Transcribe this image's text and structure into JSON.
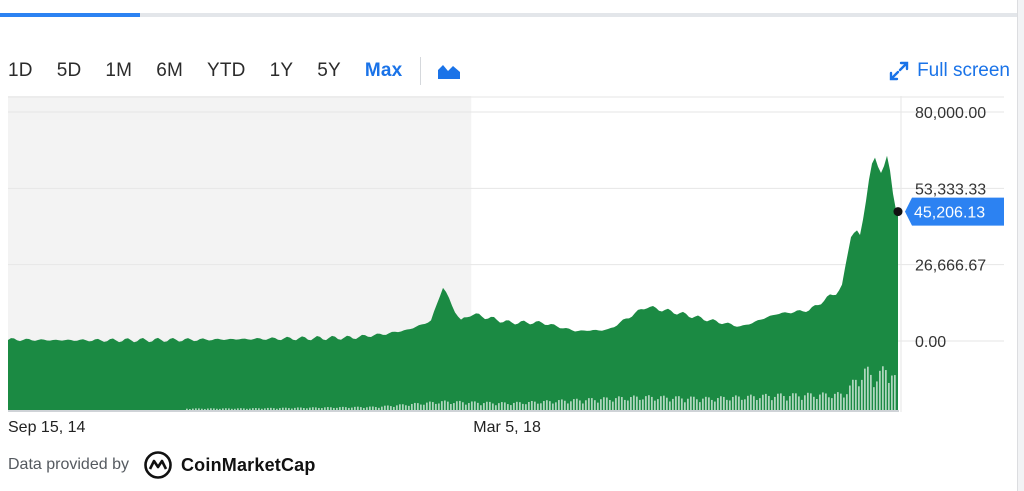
{
  "toolbar": {
    "ranges": [
      "1D",
      "5D",
      "1M",
      "6M",
      "YTD",
      "1Y",
      "5Y",
      "Max"
    ],
    "active_range": "Max",
    "chart_type_icon": "mountain-chart-icon",
    "fullscreen_label": "Full screen"
  },
  "loading_progress": 0.137,
  "footer": {
    "provided_by": "Data provided by",
    "brand": "CoinMarketCap",
    "brand_icon": "coinmarketcap-logo-icon"
  },
  "colors": {
    "area_fill": "#1b8a43",
    "accent": "#1a73e8",
    "last_price_badge": "#2c82f2",
    "shaded_region": "#f3f3f3",
    "grid": "#e6e6e6",
    "volume": "#1b8a43"
  },
  "chart_data": {
    "type": "area",
    "title": "",
    "xlabel": "",
    "ylabel": "",
    "x_ticks": [
      "Sep 15, 14",
      "Mar 5, 18"
    ],
    "y_ticks": [
      0,
      26666.67,
      53333.33,
      80000
    ],
    "y_tick_labels": [
      "0.00",
      "26,666.67",
      "53,333.33",
      "80,000.00"
    ],
    "ylim": [
      0,
      80000
    ],
    "x_range": [
      "2014-09-15",
      "2021-05-15"
    ],
    "grid": true,
    "legend": "none",
    "last_price": 45206.13,
    "last_price_label": "45,206.13",
    "series": [
      {
        "x": [
          "2014-09-15",
          "2015-01-15",
          "2015-06-15",
          "2016-01-15",
          "2016-06-15",
          "2017-01-15",
          "2017-04-15",
          "2017-07-15",
          "2017-09-15",
          "2017-11-15",
          "2017-12-17",
          "2018-01-15",
          "2018-02-05",
          "2018-03-05",
          "2018-06-15",
          "2018-09-15",
          "2018-12-15",
          "2019-03-15",
          "2019-06-26",
          "2019-09-15",
          "2019-12-15",
          "2020-03-13",
          "2020-06-15",
          "2020-09-15",
          "2020-11-15",
          "2020-12-15",
          "2021-01-08",
          "2021-02-01",
          "2021-02-21",
          "2021-03-13",
          "2021-04-14",
          "2021-05-01",
          "2021-05-15"
        ],
        "y": [
          500,
          300,
          250,
          400,
          650,
          1000,
          1200,
          2500,
          4000,
          7000,
          19000,
          11500,
          7000,
          9500,
          6500,
          6400,
          3500,
          3900,
          12000,
          10000,
          7300,
          5000,
          9400,
          10800,
          16000,
          19000,
          40000,
          35000,
          57000,
          61000,
          63000,
          52000,
          45206
        ]
      }
    ],
    "volume": {
      "x": [
        "2014-09-15",
        "2016-06-15",
        "2017-06-15",
        "2017-12-15",
        "2018-06-15",
        "2019-06-15",
        "2019-12-15",
        "2020-06-15",
        "2020-12-15",
        "2021-01-15",
        "2021-02-15",
        "2021-03-15",
        "2021-04-15",
        "2021-05-15"
      ],
      "relative": [
        0.02,
        0.03,
        0.06,
        0.16,
        0.13,
        0.25,
        0.22,
        0.28,
        0.3,
        0.55,
        0.75,
        0.6,
        0.85,
        0.45
      ]
    }
  }
}
